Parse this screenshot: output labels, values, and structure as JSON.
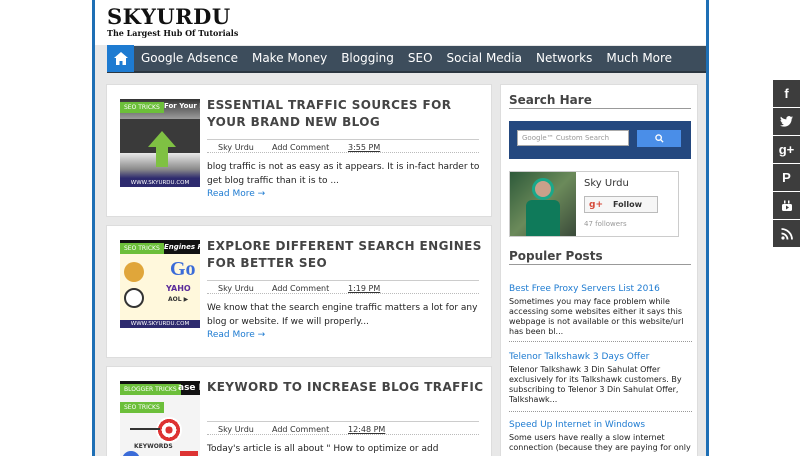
{
  "header": {
    "logo_name": "SKYURDU",
    "logo_tagline": "The Largest Hub Of Tutorials"
  },
  "nav": {
    "items": [
      "Google Adsence",
      "Make Money",
      "Blogging",
      "SEO",
      "Social Media",
      "Networks",
      "Much More"
    ]
  },
  "posts": [
    {
      "badges": [
        "SEO TRICKS"
      ],
      "thumb_text": "For Your Bra",
      "thumb_url": "WWW.SKYURDU.COM",
      "title": "ESSENTIAL TRAFFIC SOURCES FOR YOUR BRAND NEW BLOG",
      "author": "Sky Urdu",
      "comment": "Add Comment",
      "time": "3:55 PM",
      "excerpt": "blog traffic is not as easy as it appears. It is in-fact harder to get blog traffic than it is to ...",
      "more": "Read More →"
    },
    {
      "badges": [
        "SEO TRICKS"
      ],
      "thumb_text": "Engines F",
      "thumb_url": "WWW.SKYURDU.COM",
      "title": "EXPLORE DIFFERENT SEARCH ENGINES FOR BETTER SEO",
      "author": "Sky Urdu",
      "comment": "Add Comment",
      "time": "1:19 PM",
      "excerpt": "We know that the search engine traffic matters a lot for any blog or website. If we will properly...",
      "more": "Read More →"
    },
    {
      "badges": [
        "BLOGGER TRICKS",
        "SEO TRICKS"
      ],
      "thumb_text": "ase B",
      "thumb_url": "KEYWORDS",
      "title": "KEYWORD TO INCREASE BLOG TRAFFIC",
      "author": "Sky Urdu",
      "comment": "Add Comment",
      "time": "12:48 PM",
      "excerpt": "Today's article is all about \" How to optimize or add",
      "more": ""
    }
  ],
  "sidebar": {
    "search_title": "Search Hare",
    "search_placeholder": "Google™ Custom Search",
    "follow_name": "Sky Urdu",
    "follow_label": "Follow",
    "followers": "47 followers",
    "popular_title": "Populer Posts",
    "popular": [
      {
        "title": "Best Free Proxy Servers List 2016",
        "desc": "Sometimes you may face problem while accessing some websites either it says this webpage is not available or this website/url has been bl..."
      },
      {
        "title": "Telenor Talkshawk 3 Days Offer",
        "desc": "Telenor Talkshawk 3 Din Sahulat Offer exclusively for its Talkshawk customers. By subscribing to Telenor 3 Din Sahulat Offer, Talkshawk..."
      },
      {
        "title": "Speed Up Internet in Windows",
        "desc": "Some users have really a slow internet connection (because they are paying for only"
      }
    ]
  },
  "social": [
    "facebook-icon",
    "twitter-icon",
    "google-plus-icon",
    "pinterest-icon",
    "youtube-icon",
    "rss-icon"
  ],
  "colors": {
    "accent": "#1e7bd1",
    "nav": "#3d4d5c",
    "badge": "#6cbf3a",
    "search_box": "#24487f"
  }
}
